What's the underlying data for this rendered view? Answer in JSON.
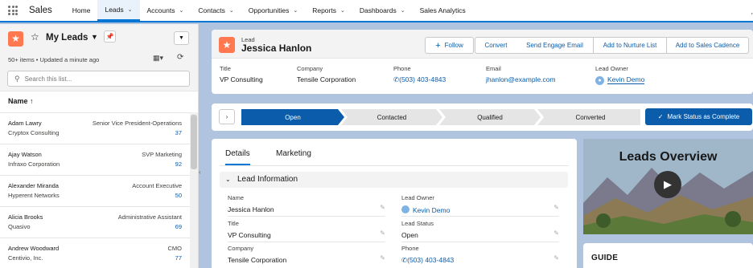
{
  "app": {
    "name": "Sales"
  },
  "nav": [
    {
      "label": "Home",
      "has_menu": false
    },
    {
      "label": "Leads",
      "has_menu": true,
      "active": true
    },
    {
      "label": "Accounts",
      "has_menu": true
    },
    {
      "label": "Contacts",
      "has_menu": true
    },
    {
      "label": "Opportunities",
      "has_menu": true
    },
    {
      "label": "Reports",
      "has_menu": true
    },
    {
      "label": "Dashboards",
      "has_menu": true
    },
    {
      "label": "Sales Analytics",
      "has_menu": false
    }
  ],
  "nav_overflow": ",",
  "list": {
    "title": "My Leads",
    "subtitle": "50+ items • Updated a minute ago",
    "search_placeholder": "Search this list...",
    "sort_label": "Name",
    "rows": [
      {
        "name": "Adam Lawry",
        "company": "Cryptox Consulting",
        "title": "Senior Vice President-Operations",
        "count": "37"
      },
      {
        "name": "Ajay Watson",
        "company": "Infraxo Corporation",
        "title": "SVP Marketing",
        "count": "92"
      },
      {
        "name": "Alexander Miranda",
        "company": "Hyperent Networks",
        "title": "Account Executive",
        "count": "50"
      },
      {
        "name": "Alicia Brooks",
        "company": "Quasivo",
        "title": "Administrative Assistant",
        "count": "69"
      },
      {
        "name": "Andrew Woodward",
        "company": "Centivio, Inc.",
        "title": "CMO",
        "count": "77"
      }
    ]
  },
  "record": {
    "type": "Lead",
    "name": "Jessica Hanlon",
    "buttons": {
      "follow": "Follow",
      "convert": "Convert",
      "engage_email": "Send Engage Email",
      "nurture": "Add to Nurture List",
      "cadence": "Add to Sales Cadence"
    },
    "fields": {
      "title_label": "Title",
      "title_value": "VP Consulting",
      "company_label": "Company",
      "company_value": "Tensile Corporation",
      "phone_label": "Phone",
      "phone_value": "(503) 403-4843",
      "email_label": "Email",
      "email_value": "jhanlon@example.com",
      "owner_label": "Lead Owner",
      "owner_value": "Kevin Demo"
    }
  },
  "path": {
    "stages": [
      "Open",
      "Contacted",
      "Qualified",
      "Converted"
    ],
    "mark_complete": "Mark Status as Complete"
  },
  "details": {
    "tabs": {
      "details": "Details",
      "marketing": "Marketing"
    },
    "section_title": "Lead Information",
    "name_label": "Name",
    "name_value": "Jessica Hanlon",
    "owner_label": "Lead Owner",
    "owner_value": "Kevin Demo",
    "title_label": "Title",
    "title_value": "VP Consulting",
    "status_label": "Lead Status",
    "status_value": "Open",
    "company_label": "Company",
    "company_value": "Tensile Corporation",
    "phone_label": "Phone",
    "phone_value": "(503) 403-4843"
  },
  "video": {
    "title": "Leads Overview"
  },
  "guide": {
    "title": "GUIDE"
  },
  "colors": {
    "brand": "#0176d3",
    "lead_icon": "#ff784f",
    "link": "#0b5cab",
    "path_active": "#0b5cab"
  }
}
